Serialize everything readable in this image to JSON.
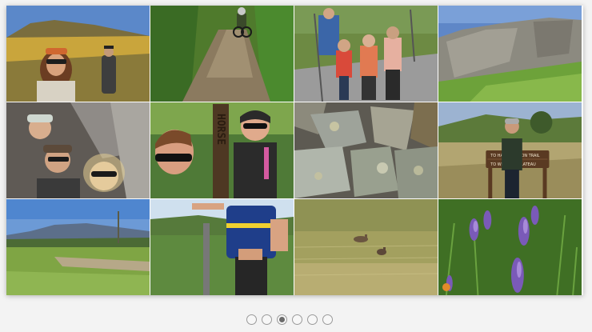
{
  "gallery": {
    "current_page": 3,
    "total_pages": 6,
    "photos": [
      {
        "id": "p1",
        "subject": "hiker-selfie-on-mountain-meadow"
      },
      {
        "id": "p2",
        "subject": "cyclist-on-dirt-trail"
      },
      {
        "id": "p3",
        "subject": "group-of-hikers-on-trail"
      },
      {
        "id": "p4",
        "subject": "rock-cliff-and-green-hillside"
      },
      {
        "id": "p5",
        "subject": "group-selfie-under-bridge"
      },
      {
        "id": "p6",
        "subject": "selfie-with-horse-trail-post"
      },
      {
        "id": "p7",
        "subject": "lichen-covered-rocks"
      },
      {
        "id": "p8",
        "subject": "hiker-at-trail-sign"
      },
      {
        "id": "p9",
        "subject": "valley-with-mountains"
      },
      {
        "id": "p10",
        "subject": "hiker-with-poles-at-trail-marker"
      },
      {
        "id": "p11",
        "subject": "deer-in-dry-grass-field"
      },
      {
        "id": "p12",
        "subject": "purple-lupine-wildflowers"
      }
    ],
    "trail_post_text": "HORSE",
    "trail_sign_lines": [
      "TO HAWK CANYON TRAIL",
      "TO WESTERN PLATEAU"
    ]
  },
  "pager": {
    "dots": [
      {
        "page": 1,
        "active": false
      },
      {
        "page": 2,
        "active": false
      },
      {
        "page": 3,
        "active": true
      },
      {
        "page": 4,
        "active": false
      },
      {
        "page": 5,
        "active": false
      },
      {
        "page": 6,
        "active": false
      }
    ]
  },
  "colors": {
    "page_background": "#f3f3f3",
    "dot_border": "#9a9a9a",
    "dot_active": "#6b6b6b"
  }
}
